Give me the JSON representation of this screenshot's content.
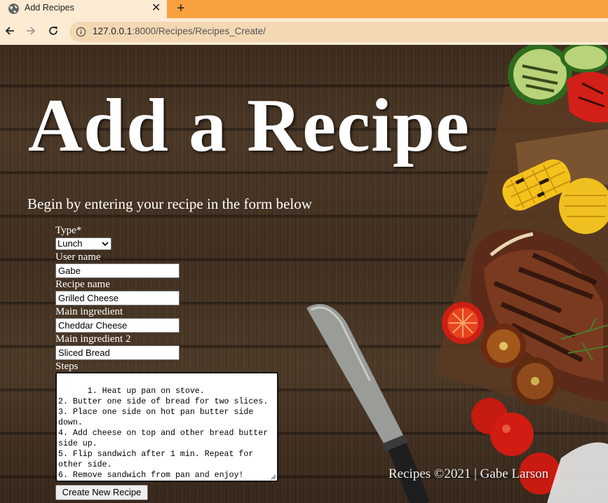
{
  "browser": {
    "tab_title": "Add Recipes",
    "tab_icon": "globe-icon",
    "close_icon": "close-icon",
    "new_tab_icon": "plus-icon",
    "url_host": "127.0.0.1",
    "url_rest": ":8000/Recipes/Recipes_Create/",
    "accent_color": "#f7a23f"
  },
  "page": {
    "heading": "Add a Recipe",
    "subtitle": "Begin by entering your recipe in the form below",
    "footer": "Recipes ©2021 | Gabe Larson"
  },
  "form": {
    "type_label": "Type*",
    "type_value": "Lunch",
    "username_label": "User name",
    "username_value": "Gabe",
    "recipe_name_label": "Recipe name",
    "recipe_name_value": "Grilled Cheese",
    "main_ingredient_label": "Main ingredient",
    "main_ingredient_value": "Cheddar Cheese",
    "main_ingredient2_label": "Main ingredient 2",
    "main_ingredient2_value": "Sliced Bread",
    "steps_label": "Steps",
    "steps_value": "1. Heat up pan on stove.\n2. Butter one side of bread for two slices.\n3. Place one side on hot pan butter side down.\n4. Add cheese on top and other bread butter side up.\n5. Flip sandwich after 1 min. Repeat for other side.\n6. Remove sandwich from pan and enjoy!",
    "submit_label": "Create New Recipe"
  }
}
